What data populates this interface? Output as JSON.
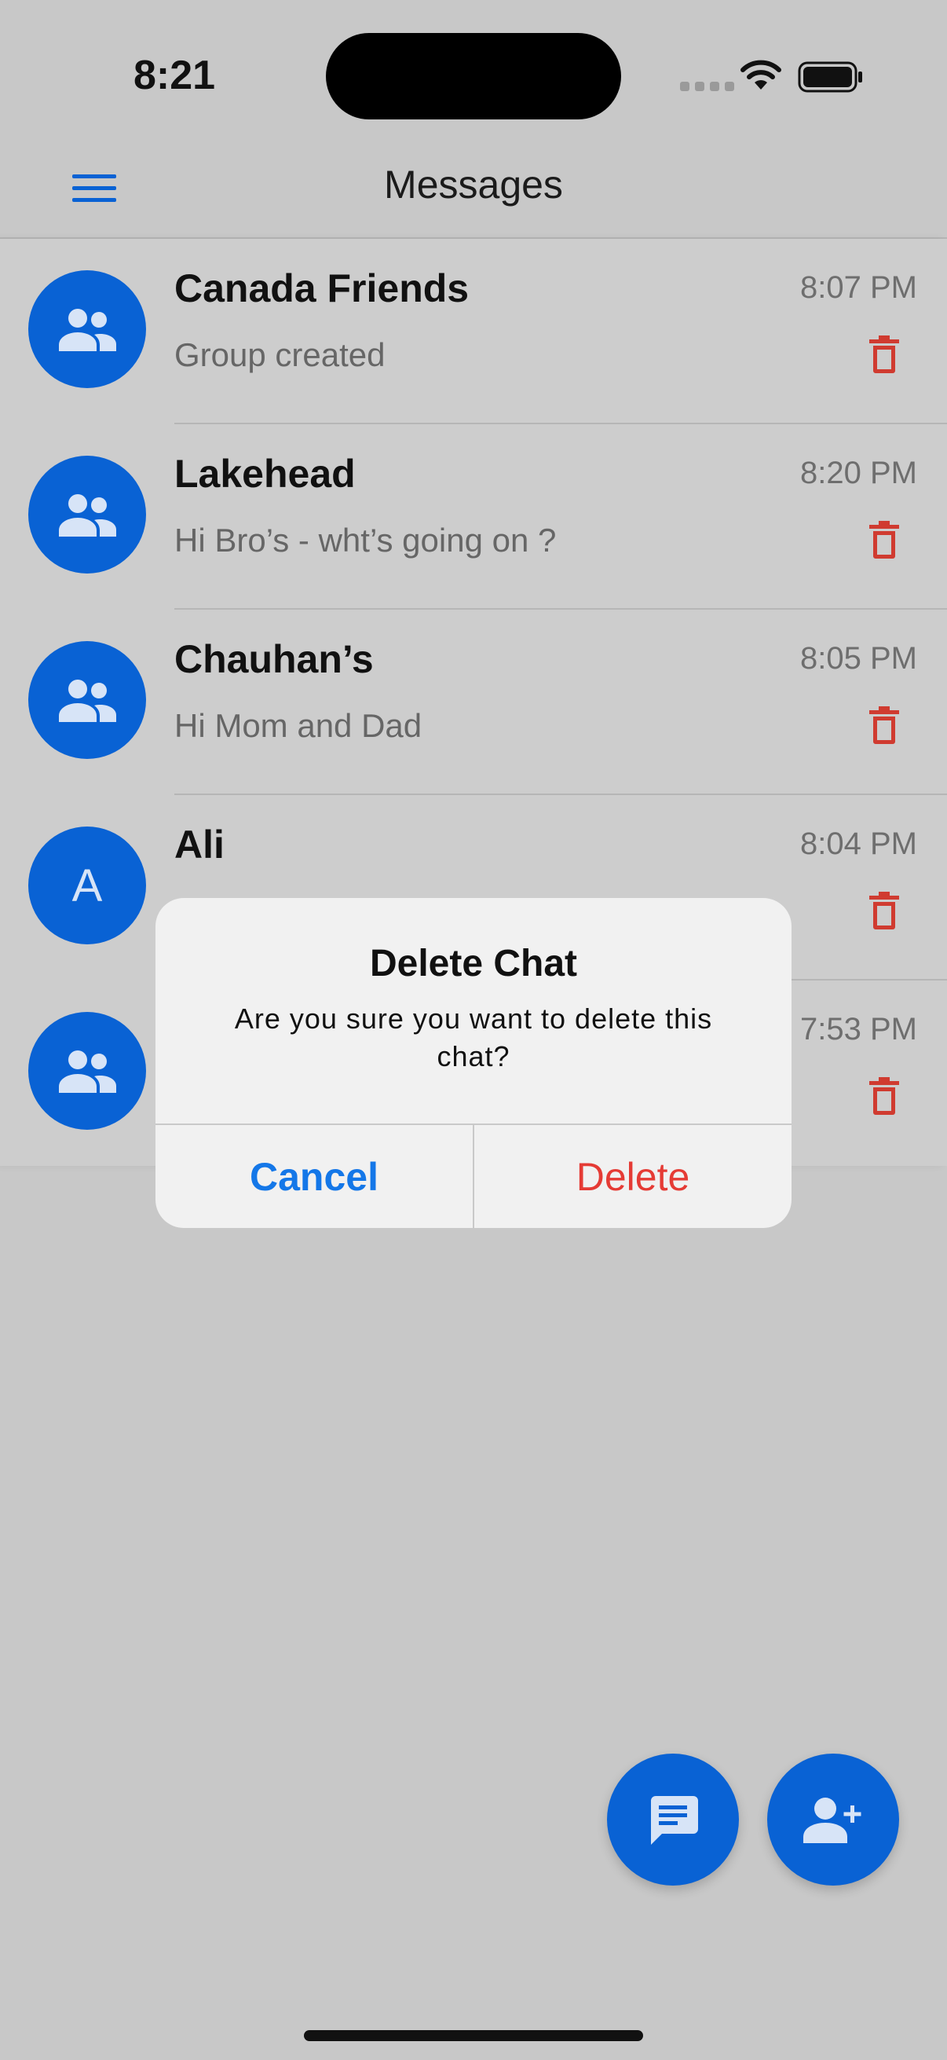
{
  "status_bar": {
    "time": "8:21"
  },
  "navbar": {
    "title": "Messages"
  },
  "chats": [
    {
      "name": "Canada Friends",
      "time": "8:07 PM",
      "preview": "Group created",
      "avatar": "group-icon",
      "initial": ""
    },
    {
      "name": "Lakehead",
      "time": "8:20 PM",
      "preview": "Hi Bro’s - wht’s going on ?",
      "avatar": "group-icon",
      "initial": ""
    },
    {
      "name": "Chauhan’s",
      "time": "8:05 PM",
      "preview": "Hi Mom and Dad",
      "avatar": "group-icon",
      "initial": ""
    },
    {
      "name": "Ali",
      "time": "8:04 PM",
      "preview": "",
      "avatar": "initial",
      "initial": "A"
    },
    {
      "name": "",
      "time": "7:53 PM",
      "preview": "",
      "avatar": "group-icon",
      "initial": ""
    }
  ],
  "alert": {
    "title": "Delete Chat",
    "message": "Are you sure you want to delete this chat?",
    "cancel_label": "Cancel",
    "delete_label": "Delete"
  },
  "colors": {
    "accent": "#0962d4",
    "destructive": "#e53b35",
    "alert_button_blue": "#1477e8"
  }
}
